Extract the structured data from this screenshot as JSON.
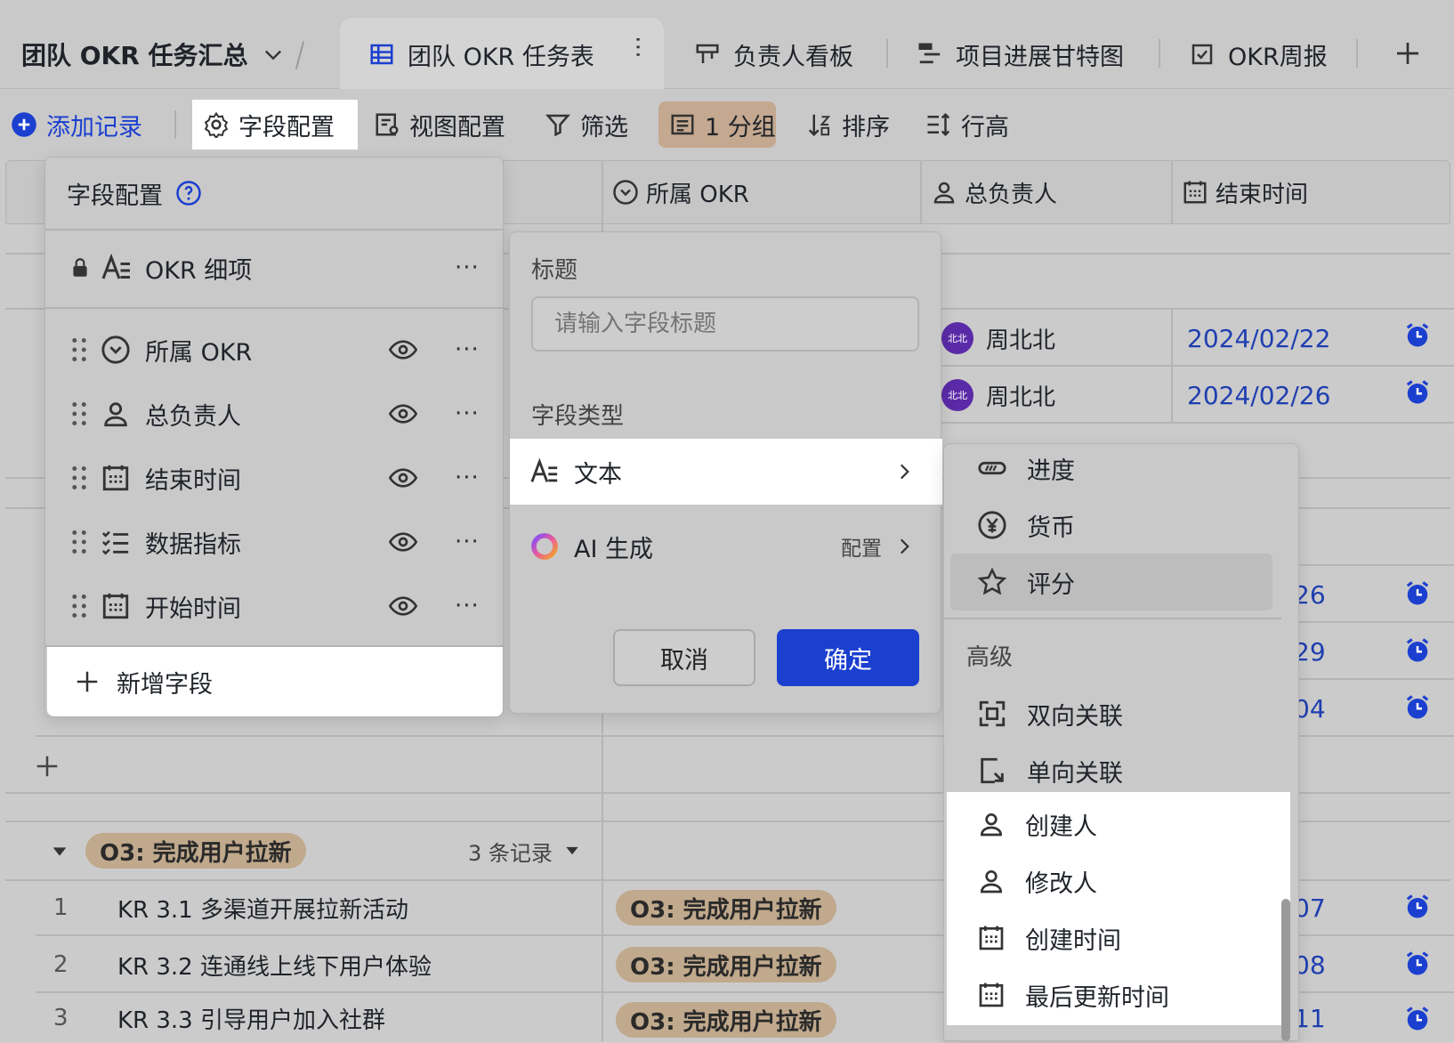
{
  "header": {
    "base_title": "团队 OKR 任务汇总",
    "tabs": [
      {
        "label": "团队 OKR 任务表",
        "active": true
      },
      {
        "label": "负责人看板"
      },
      {
        "label": "项目进展甘特图"
      },
      {
        "label": "OKR周报"
      }
    ]
  },
  "toolbar": {
    "add_record": "添加记录",
    "field_config": "字段配置",
    "view_config": "视图配置",
    "filter": "筛选",
    "group": "1 分组",
    "sort": "排序",
    "row_height": "行高"
  },
  "columns": {
    "okr": "所属 OKR",
    "owner": "总负责人",
    "end_time": "结束时间"
  },
  "rows_top": [
    {
      "owner": "周北北",
      "avatar": "北北",
      "end": "2024/02/22"
    },
    {
      "owner": "周北北",
      "avatar": "北北",
      "end": "2024/02/26"
    }
  ],
  "rows_mid_dates": [
    "26",
    "29",
    "04"
  ],
  "group3": {
    "label": "O3: 完成用户拉新",
    "count": "3 条记录",
    "rows": [
      {
        "num": "1",
        "title": "KR 3.1 多渠道开展拉新活动",
        "okr": "O3: 完成用户拉新",
        "date": "07"
      },
      {
        "num": "2",
        "title": "KR 3.2 连通线上线下用户体验",
        "okr": "O3: 完成用户拉新",
        "date": "08"
      },
      {
        "num": "3",
        "title": "KR 3.3 引导用户加入社群",
        "okr": "O3: 完成用户拉新",
        "date": "11"
      }
    ]
  },
  "field_panel": {
    "title": "字段配置",
    "primary_field": "OKR 细项",
    "fields": [
      "所属 OKR",
      "总负责人",
      "结束时间",
      "数据指标",
      "开始时间"
    ],
    "add_field": "新增字段"
  },
  "edit_panel": {
    "title_label": "标题",
    "title_placeholder": "请输入字段标题",
    "type_label": "字段类型",
    "type_text": "文本",
    "type_ai": "AI 生成",
    "ai_config": "配置",
    "cancel": "取消",
    "confirm": "确定"
  },
  "type_menu": {
    "basic": [
      "进度",
      "货币",
      "评分"
    ],
    "advanced_label": "高级",
    "advanced": [
      "双向关联",
      "单向关联",
      "创建人",
      "修改人",
      "创建时间",
      "最后更新时间"
    ]
  },
  "colors": {
    "accent": "#1b3fcf",
    "date": "#1f3fb0",
    "pill": "#c0a98c",
    "avatar": "#5b2aa8"
  }
}
